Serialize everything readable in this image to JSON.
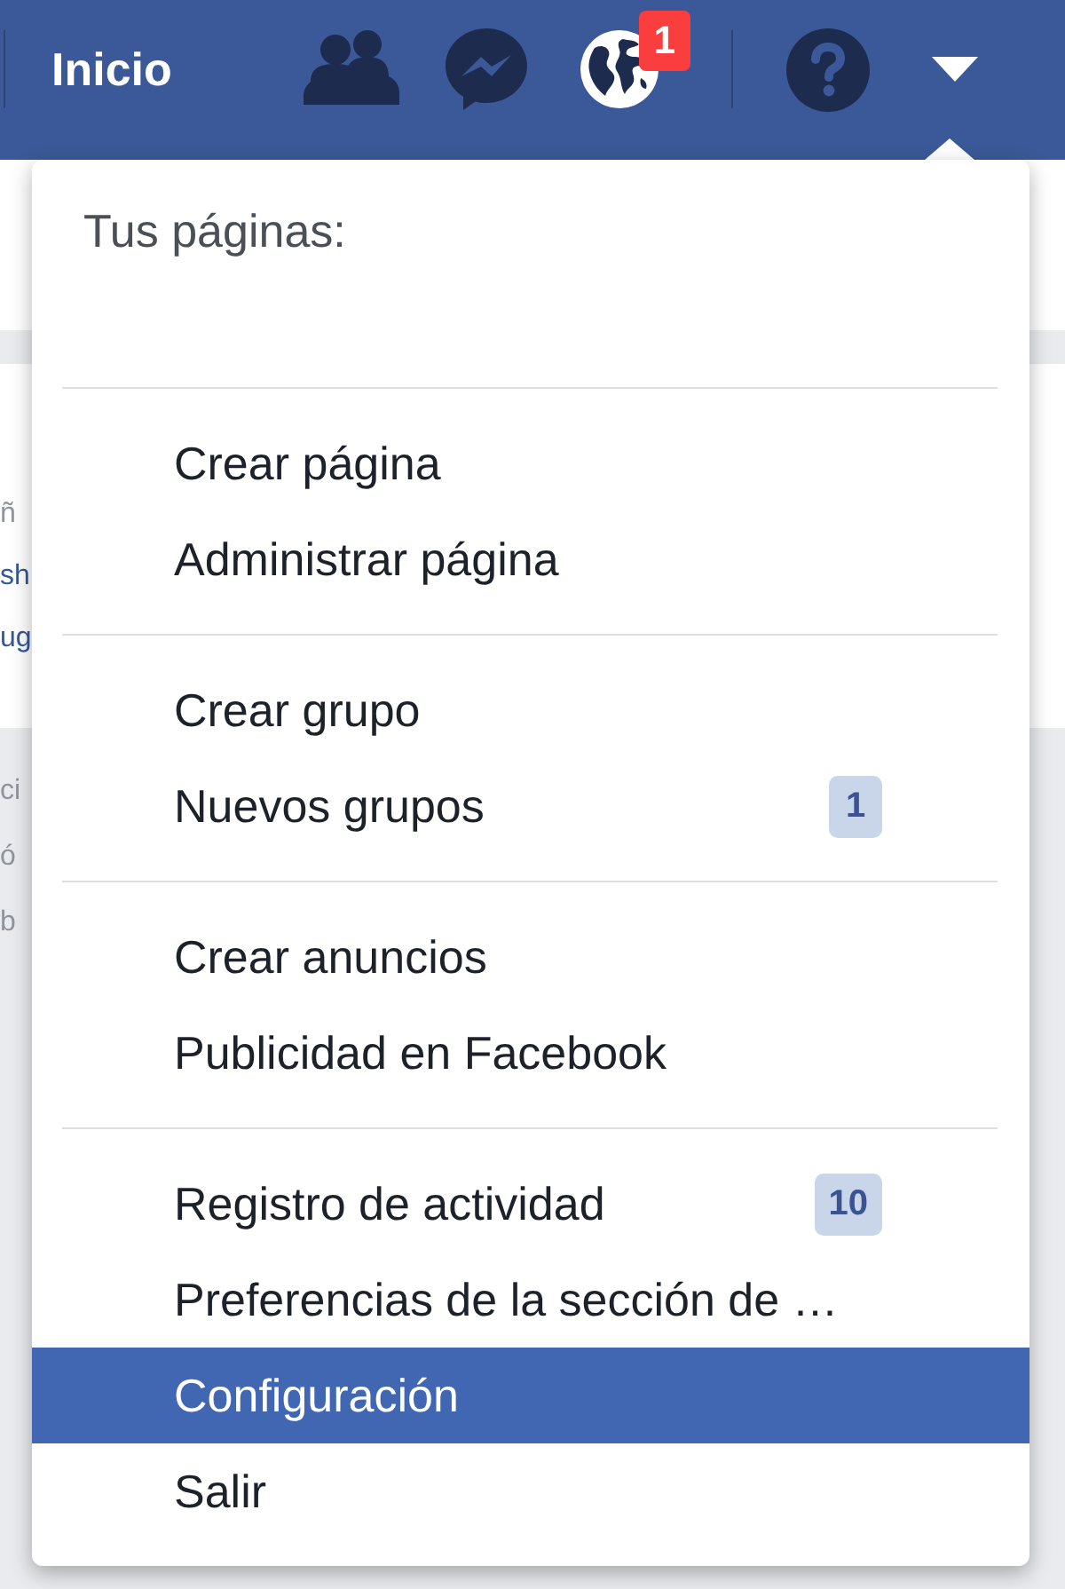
{
  "top_bar": {
    "home_link": "Inicio",
    "notification_count": "1"
  },
  "background": {
    "card_lines": [
      {
        "text": "ñ",
        "kind": "muted"
      },
      {
        "text": "sh",
        "kind": "link"
      },
      {
        "text": "ug",
        "kind": "link"
      }
    ],
    "feed_lines": [
      "ci",
      "ó",
      "b"
    ]
  },
  "menu": {
    "heading": "Tus páginas:",
    "sections": [
      {
        "items": [
          {
            "label": "Crear página",
            "selected": false
          },
          {
            "label": "Administrar página",
            "selected": false
          }
        ]
      },
      {
        "items": [
          {
            "label": "Crear grupo",
            "selected": false
          },
          {
            "label": "Nuevos grupos",
            "selected": false,
            "badge": "1"
          }
        ]
      },
      {
        "items": [
          {
            "label": "Crear anuncios",
            "selected": false
          },
          {
            "label": "Publicidad en Facebook",
            "selected": false
          }
        ]
      },
      {
        "items": [
          {
            "label": "Registro de actividad",
            "selected": false,
            "badge": "10"
          },
          {
            "label": "Preferencias de la sección de …",
            "selected": false
          },
          {
            "label": "Configuración",
            "selected": true
          },
          {
            "label": "Salir",
            "selected": false
          }
        ]
      }
    ]
  }
}
